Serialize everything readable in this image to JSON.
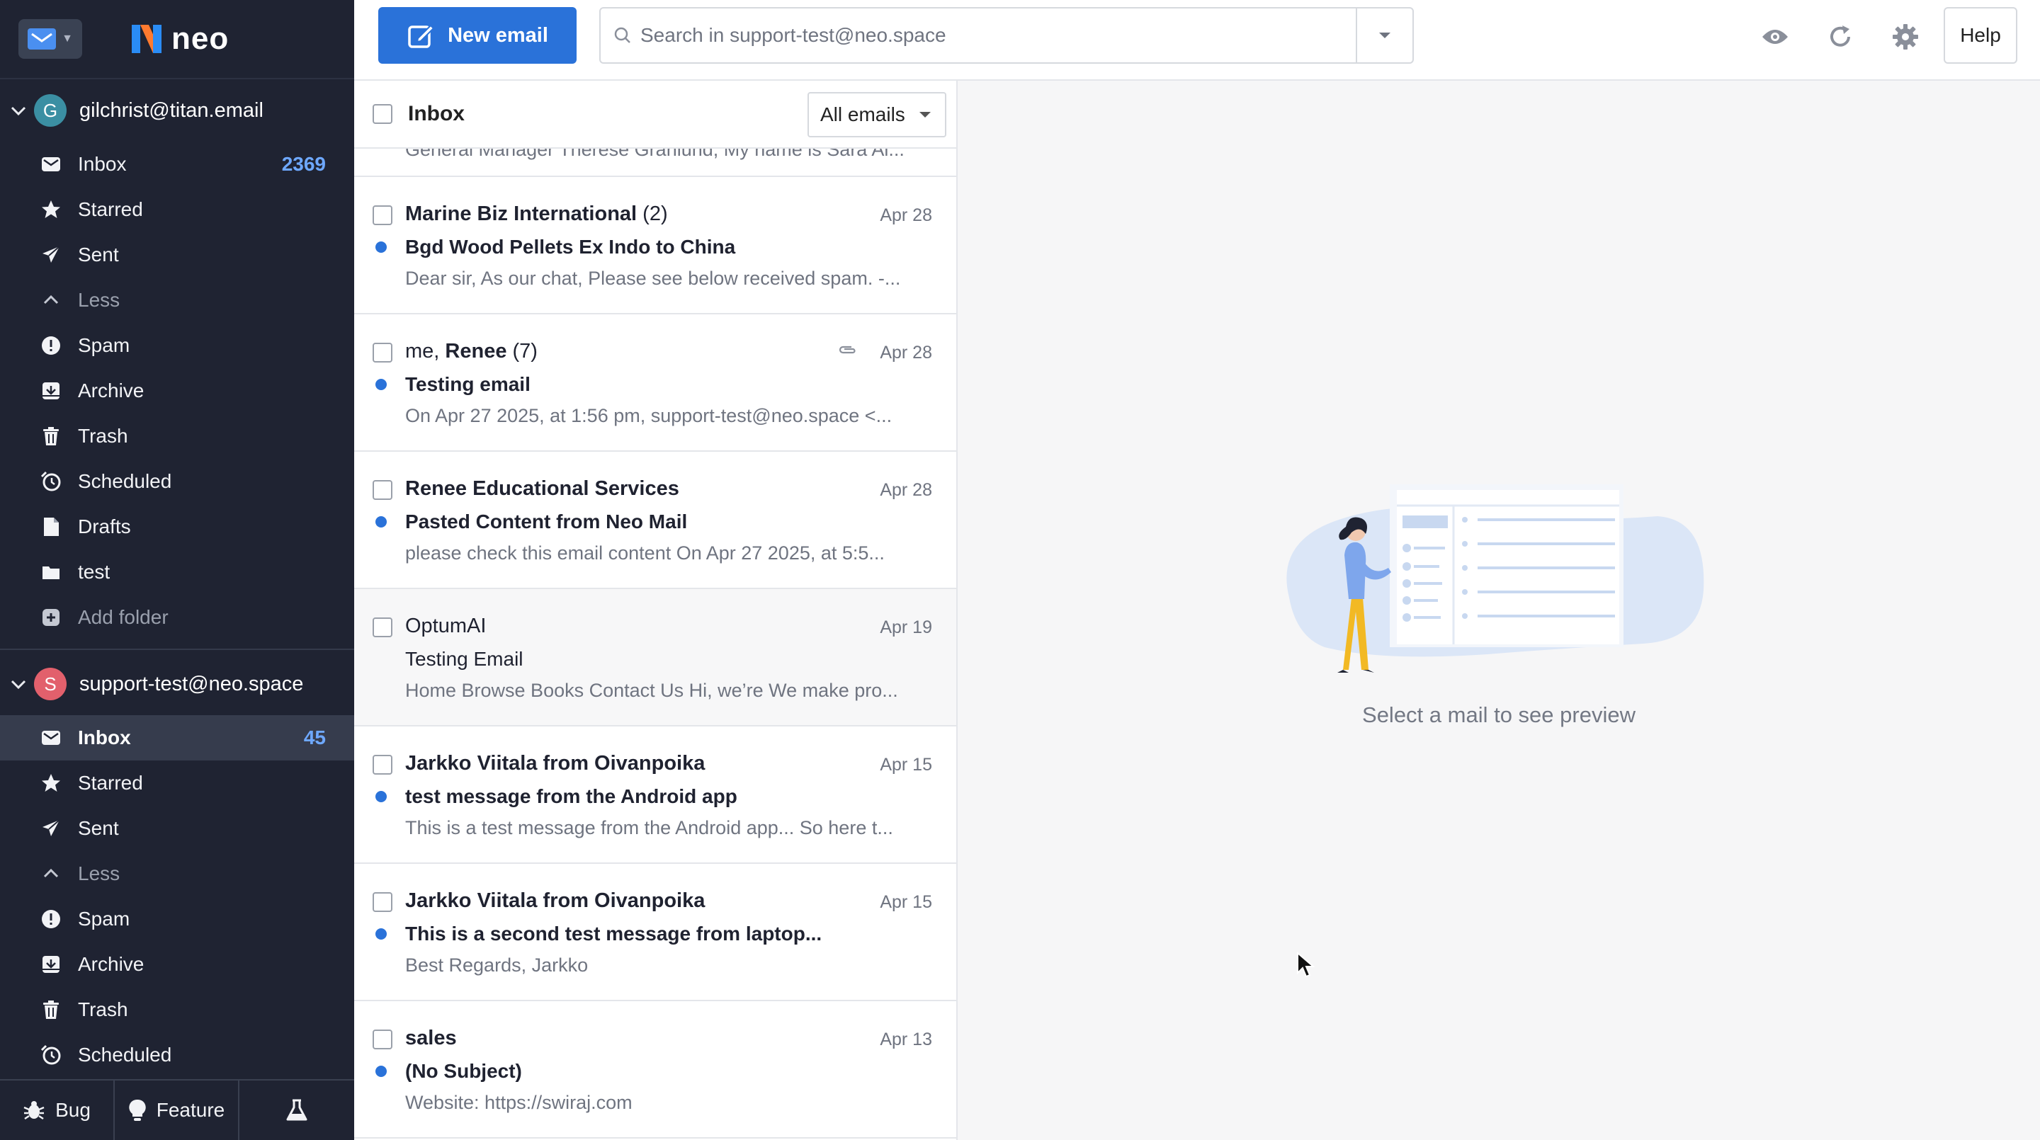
{
  "app": {
    "logo_text": "neo"
  },
  "accounts": [
    {
      "email": "gilchrist@titan.email",
      "avatar_letter": "G",
      "avatar_color": "#3b8fa3",
      "folders": [
        {
          "label": "Inbox",
          "count": "2369",
          "icon": "inbox-icon"
        },
        {
          "label": "Starred",
          "count": "",
          "icon": "star-icon"
        },
        {
          "label": "Sent",
          "count": "",
          "icon": "send-icon"
        },
        {
          "label": "Less",
          "count": "",
          "icon": "chevron-up-icon"
        },
        {
          "label": "Spam",
          "count": "",
          "icon": "spam-icon"
        },
        {
          "label": "Archive",
          "count": "",
          "icon": "archive-icon"
        },
        {
          "label": "Trash",
          "count": "",
          "icon": "trash-icon"
        },
        {
          "label": "Scheduled",
          "count": "",
          "icon": "scheduled-icon"
        },
        {
          "label": "Drafts",
          "count": "",
          "icon": "drafts-icon"
        },
        {
          "label": "test",
          "count": "",
          "icon": "folder-icon"
        },
        {
          "label": "Add folder",
          "count": "",
          "icon": "add-folder-icon"
        }
      ]
    },
    {
      "email": "support-test@neo.space",
      "avatar_letter": "S",
      "avatar_color": "#e2606c",
      "folders": [
        {
          "label": "Inbox",
          "count": "45",
          "icon": "inbox-icon"
        },
        {
          "label": "Starred",
          "count": "",
          "icon": "star-icon"
        },
        {
          "label": "Sent",
          "count": "",
          "icon": "send-icon"
        },
        {
          "label": "Less",
          "count": "",
          "icon": "chevron-up-icon"
        },
        {
          "label": "Spam",
          "count": "",
          "icon": "spam-icon"
        },
        {
          "label": "Archive",
          "count": "",
          "icon": "archive-icon"
        },
        {
          "label": "Trash",
          "count": "",
          "icon": "trash-icon"
        },
        {
          "label": "Scheduled",
          "count": "",
          "icon": "scheduled-icon"
        }
      ]
    }
  ],
  "sidebar_footer": {
    "bug_label": "Bug",
    "feature_label": "Feature"
  },
  "toolbar": {
    "new_email_label": "New email",
    "search_placeholder": "Search in support-test@neo.space",
    "help_label": "Help"
  },
  "list": {
    "title": "Inbox",
    "filter_label": "All emails",
    "partial_snippet": "General Manager Therese Granlund, My name is Sara Al...",
    "emails": [
      {
        "sender": "Marine Biz International",
        "thread_count": " (2)",
        "date": "Apr 28",
        "subject": "Bgd Wood Pellets Ex Indo to China",
        "snippet": "Dear sir, As our chat, Please see below received spam. -...",
        "unread": true,
        "attachment": false,
        "sender_prefix": ""
      },
      {
        "sender": "Renee",
        "thread_count": " (7)",
        "date": "Apr 28",
        "subject": "Testing email",
        "snippet": "On Apr 27 2025, at 1:56 pm, support-test@neo.space <...",
        "unread": true,
        "attachment": true,
        "sender_prefix": "me, "
      },
      {
        "sender": "Renee Educational Services",
        "thread_count": "",
        "date": "Apr 28",
        "subject": "Pasted Content from Neo Mail",
        "snippet": "please check this email content On Apr 27 2025, at 5:5...",
        "unread": true,
        "attachment": false,
        "sender_prefix": ""
      },
      {
        "sender": "OptumAI",
        "thread_count": "",
        "date": "Apr 19",
        "subject": "Testing Email",
        "snippet": "Home Browse Books Contact Us Hi, we’re We make pro...",
        "unread": false,
        "attachment": false,
        "sender_prefix": ""
      },
      {
        "sender": "Jarkko Viitala from Oivanpoika",
        "thread_count": "",
        "date": "Apr 15",
        "subject": "test message from the Android app",
        "snippet": "This is a test message from the Android app... So here t...",
        "unread": true,
        "attachment": false,
        "sender_prefix": ""
      },
      {
        "sender": "Jarkko Viitala from Oivanpoika",
        "thread_count": "",
        "date": "Apr 15",
        "subject": "This is a second test message from laptop...",
        "snippet": "Best Regards, Jarkko",
        "unread": true,
        "attachment": false,
        "sender_prefix": ""
      },
      {
        "sender": "sales",
        "thread_count": "",
        "date": "Apr 13",
        "subject": "(No Subject)",
        "snippet": "Website:      https://swiraj.com",
        "unread": true,
        "attachment": false,
        "sender_prefix": ""
      }
    ]
  },
  "preview": {
    "empty_text": "Select a mail to see preview"
  },
  "colors": {
    "accent": "#2a72d9",
    "sidebar_bg": "#1f2332",
    "unread_count": "#6ea8ff"
  }
}
